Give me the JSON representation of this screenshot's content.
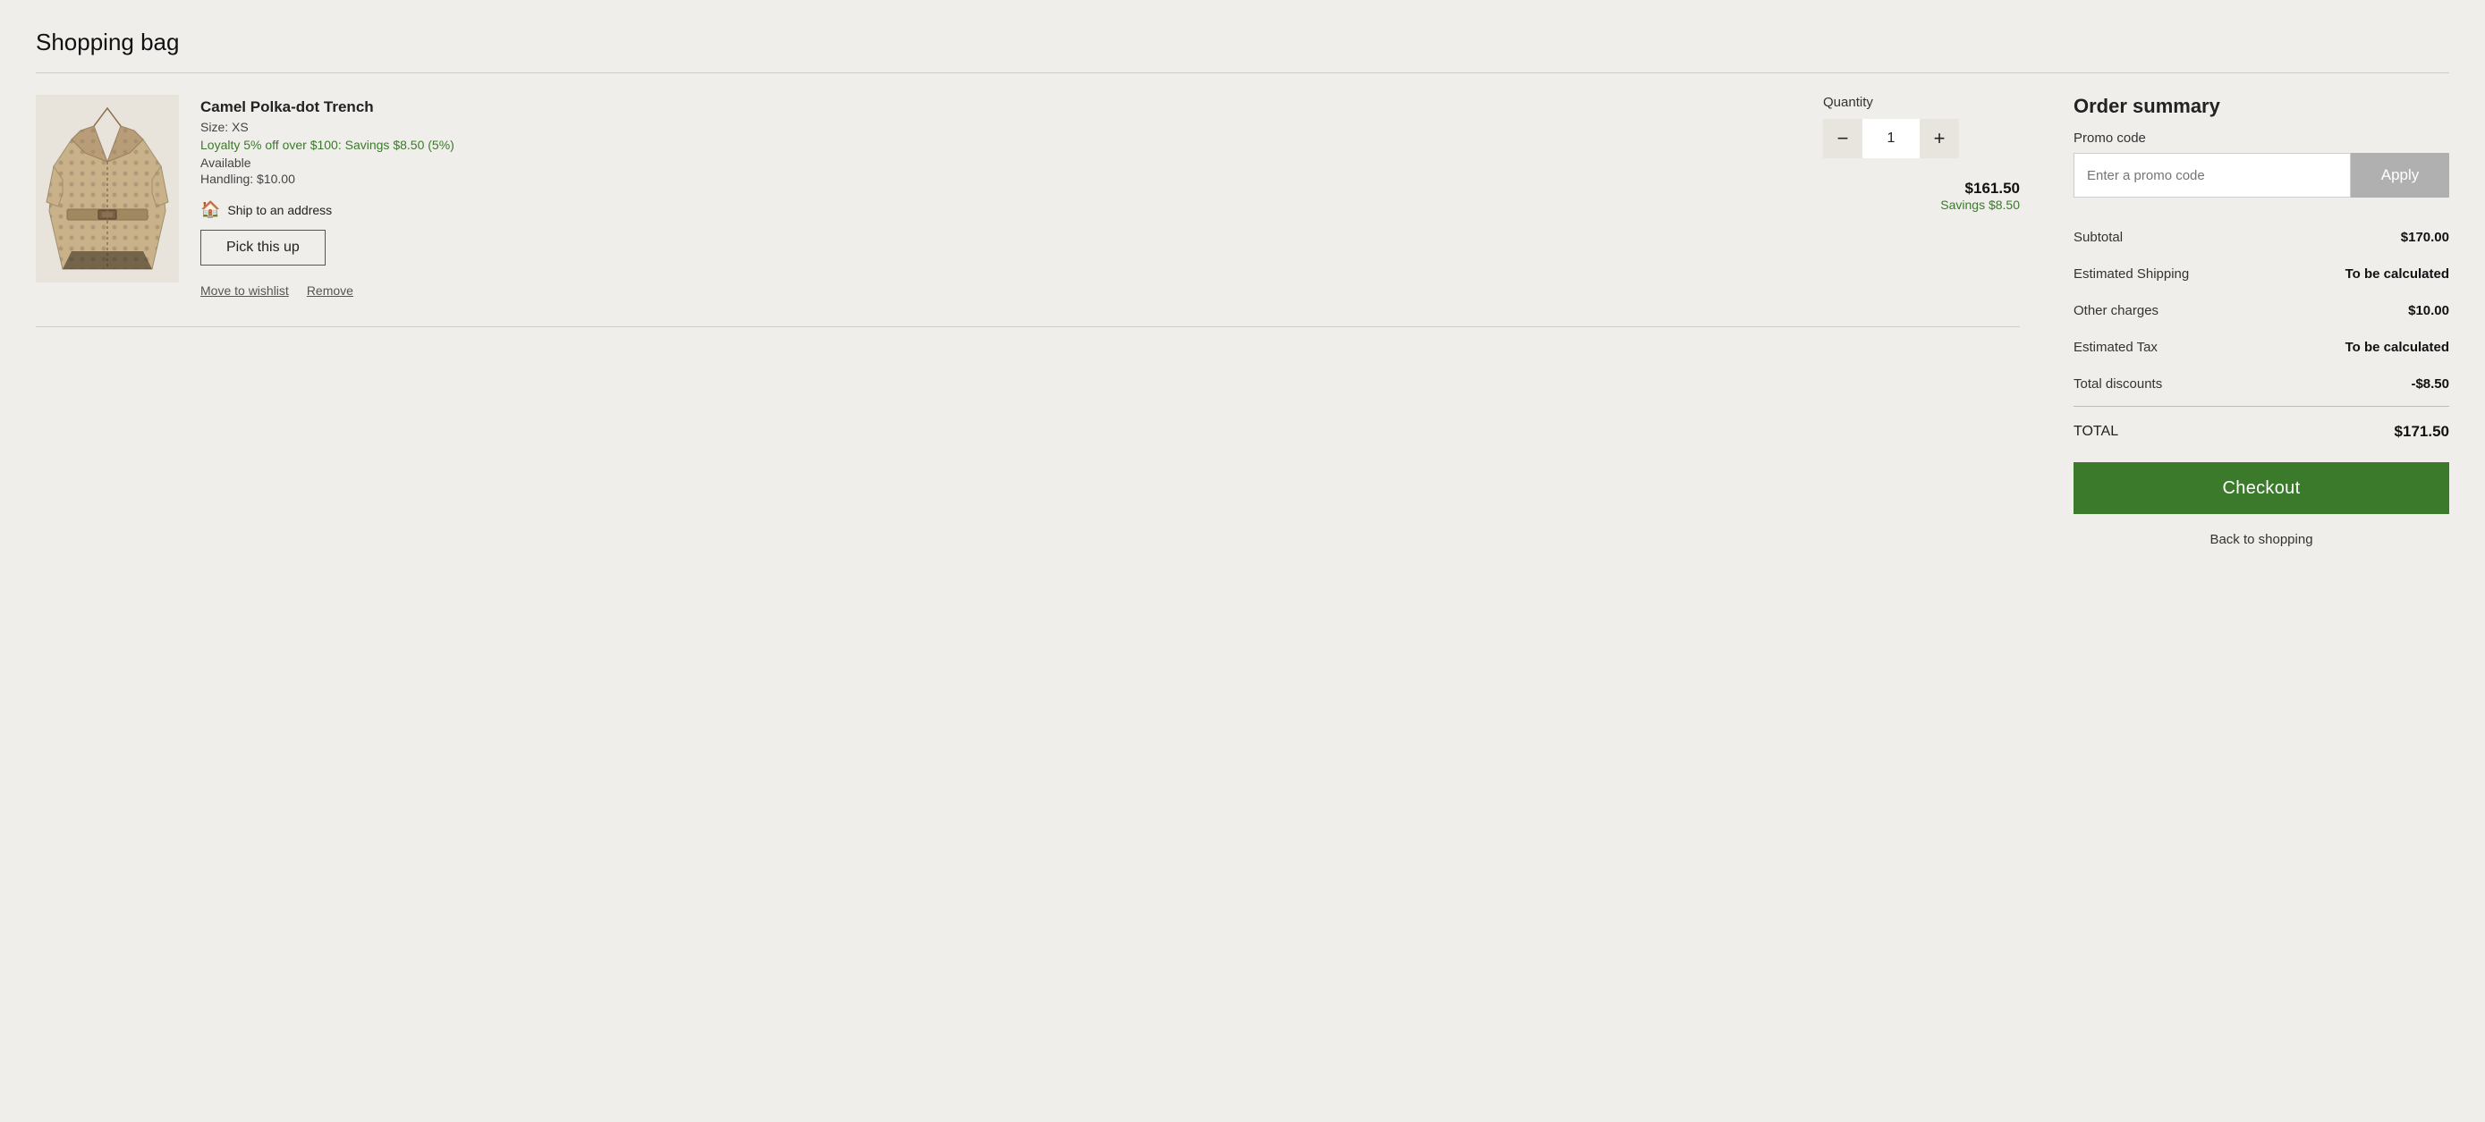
{
  "page": {
    "title": "Shopping bag"
  },
  "cart": {
    "items": [
      {
        "id": "item-1",
        "name": "Camel Polka-dot Trench",
        "size": "Size: XS",
        "loyalty": "Loyalty 5% off over $100: Savings $8.50 (5%)",
        "availability": "Available",
        "handling": "Handling: $10.00",
        "ship_to": "Ship to an address",
        "pick_up_label": "Pick this up",
        "quantity": "1",
        "price": "$161.50",
        "savings": "Savings $8.50",
        "move_to_wishlist": "Move to wishlist",
        "remove": "Remove"
      }
    ]
  },
  "quantity": {
    "label": "Quantity",
    "minus": "−",
    "plus": "+"
  },
  "order_summary": {
    "title": "Order summary",
    "promo_label": "Promo code",
    "promo_placeholder": "Enter a promo code",
    "apply_label": "Apply",
    "rows": [
      {
        "label": "Subtotal",
        "value": "$170.00",
        "bold_value": true
      },
      {
        "label": "Estimated Shipping",
        "value": "To be calculated",
        "bold_value": true
      },
      {
        "label": "Other charges",
        "value": "$10.00",
        "bold_value": true
      },
      {
        "label": "Estimated Tax",
        "value": "To be calculated",
        "bold_value": true
      },
      {
        "label": "Total discounts",
        "value": "-$8.50",
        "bold_value": true
      }
    ],
    "total_label": "TOTAL",
    "total_value": "$171.50",
    "checkout_label": "Checkout",
    "back_label": "Back to shopping"
  },
  "colors": {
    "green_accent": "#3a7a2a",
    "loyalty_green": "#3a7a2a",
    "apply_gray": "#b0b0b0",
    "bg": "#f0eeeb"
  }
}
